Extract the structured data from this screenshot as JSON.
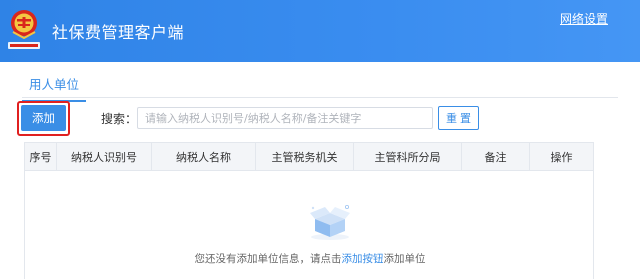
{
  "app": {
    "title": "社保费管理客户端",
    "network_settings": "网络设置"
  },
  "tabs": [
    {
      "label": "用人单位"
    }
  ],
  "toolbar": {
    "add_label": "添加",
    "search_label": "搜索：",
    "search_placeholder": "请输入纳税人识别号/纳税人名称/备注关键字",
    "reset_label": "重 置"
  },
  "table": {
    "columns": [
      "序号",
      "纳税人识别号",
      "纳税人名称",
      "主管税务机关",
      "主管科所分局",
      "备注",
      "操作"
    ]
  },
  "empty_state": {
    "prefix": "您还没有添加单位信息，请点击",
    "link": "添加按钮",
    "suffix": "添加单位"
  },
  "colors": {
    "header": "#3a8ee6",
    "accent": "#3a8ee6",
    "highlight": "#e02020"
  }
}
